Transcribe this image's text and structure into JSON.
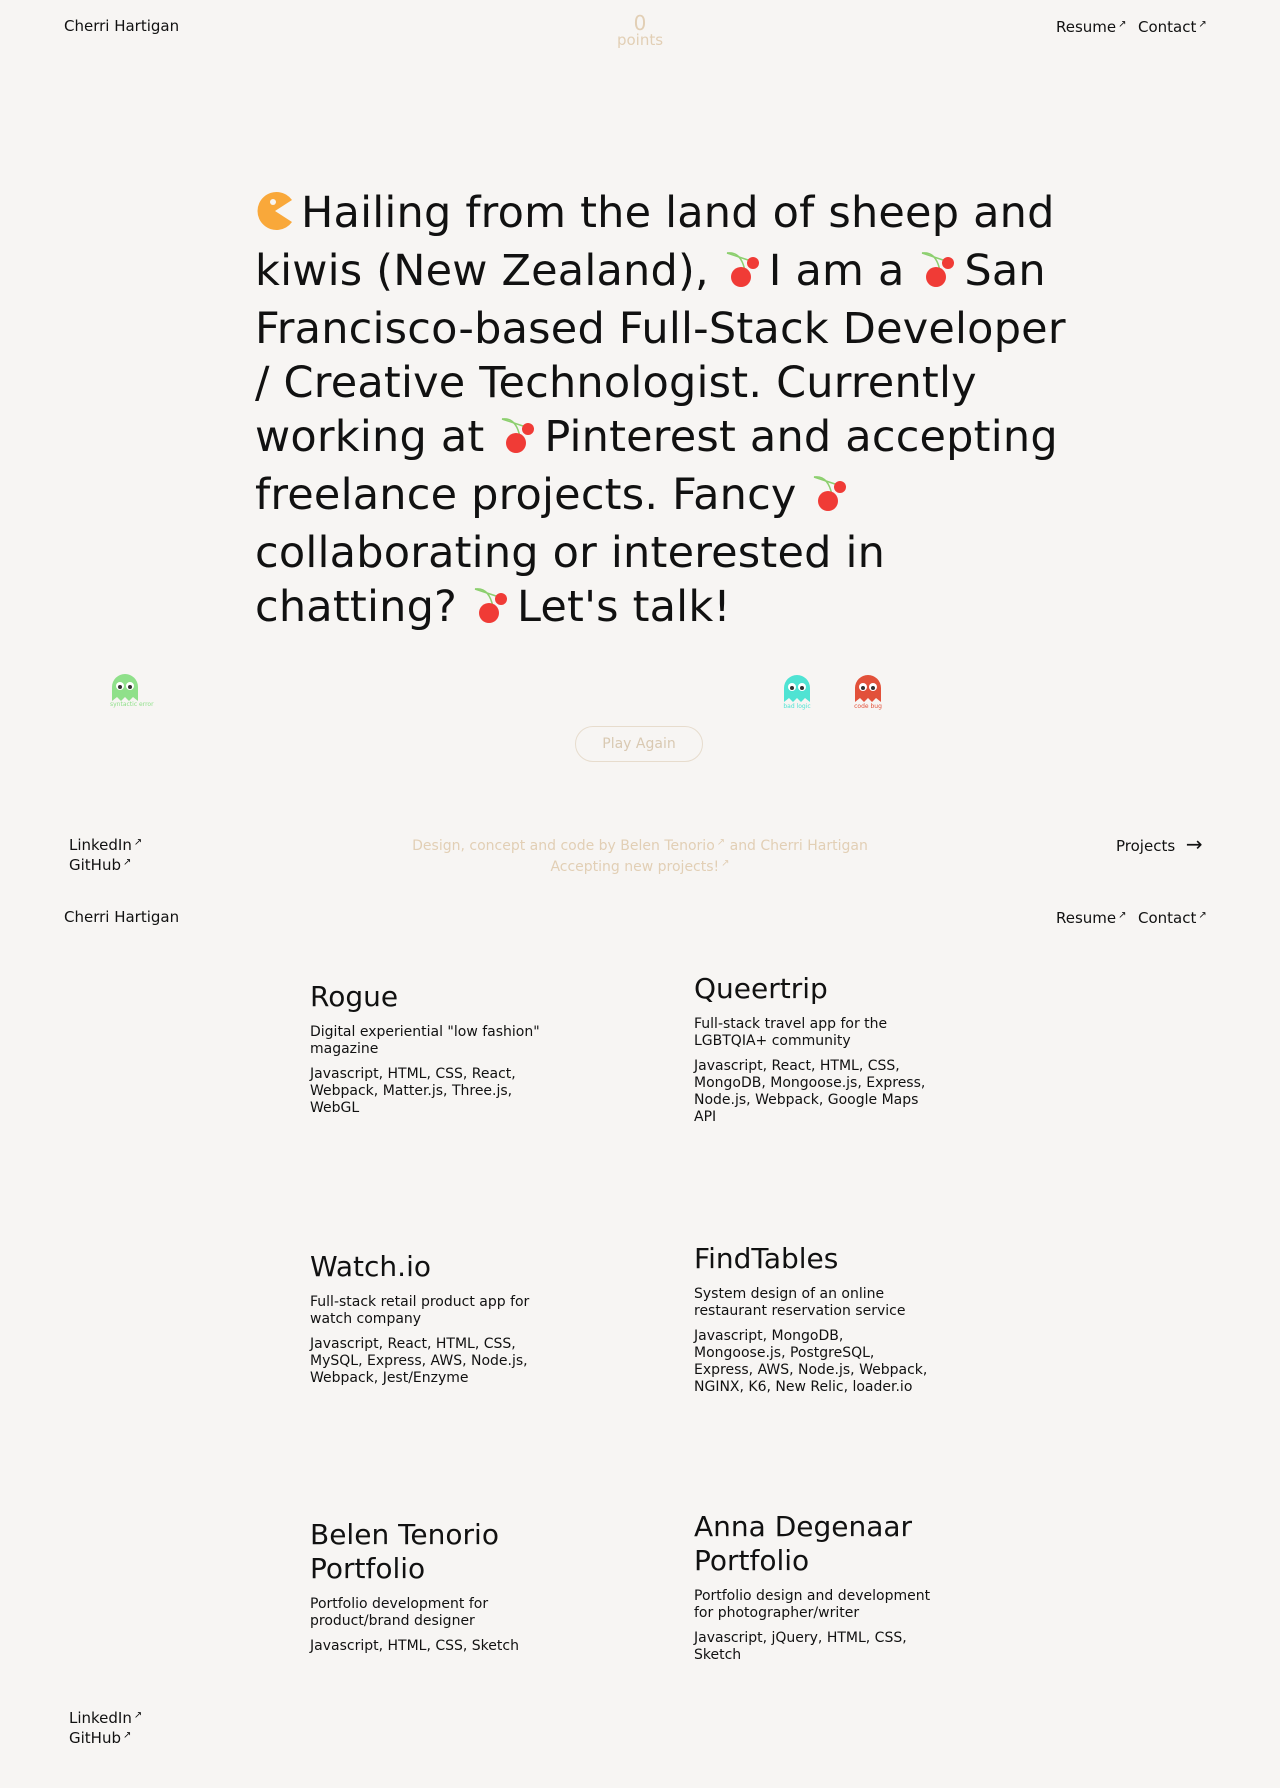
{
  "header": {
    "name": "Cherri Hartigan",
    "score_value": "0",
    "score_label": "points",
    "resume_label": "Resume",
    "contact_label": "Contact",
    "external_mark": "↗"
  },
  "hero": {
    "seg1": "Hailing from the land of sheep and kiwis (New Zealand),",
    "seg2": "I am a",
    "seg3": "San Francisco-based Full-Stack Developer / Creative Technologist. Currently working at",
    "seg4": "Pinterest and accepting freelance projects. Fancy",
    "seg5": "collaborating or interested in chatting?",
    "seg6": "Let's talk!"
  },
  "ghosts": [
    {
      "label": "syntactic error",
      "color": "#8fe08a"
    },
    {
      "label": "bad logic",
      "color": "#4fe3d3"
    },
    {
      "label": "code bug",
      "color": "#e2513a"
    }
  ],
  "colors": {
    "pacman": "#f9a83a",
    "cherry": "#f03b36",
    "stem": "#8ccf6e"
  },
  "play_again_label": "Play Again",
  "footer": {
    "linkedin": "LinkedIn",
    "github": "GitHub",
    "credit_prefix": "Design, concept and code by Belen Tenorio",
    "credit_suffix": "and Cherri Hartigan",
    "accepting": "Accepting new projects!",
    "projects_label": "Projects",
    "projects_arrow": "→"
  },
  "projects": [
    {
      "title": "Rogue",
      "desc": "Digital experiential \"low fashion\" magazine",
      "tech": "Javascript, HTML, CSS, React, Webpack, Matter.js, Three.js, WebGL"
    },
    {
      "title": "Queertrip",
      "desc": "Full-stack travel app for the LGBTQIA+ community",
      "tech": "Javascript, React, HTML, CSS, MongoDB, Mongoose.js, Express, Node.js, Webpack, Google Maps API"
    },
    {
      "title": "Watch.io",
      "desc": "Full-stack retail product app for watch company",
      "tech": "Javascript, React, HTML, CSS, MySQL, Express, AWS, Node.js, Webpack, Jest/Enzyme"
    },
    {
      "title": "FindTables",
      "desc": "System design of an online restaurant reservation service",
      "tech": "Javascript, MongoDB, Mongoose.js, PostgreSQL, Express, AWS, Node.js, Webpack, NGINX, K6, New Relic, loader.io"
    },
    {
      "title": "Belen Tenorio Portfolio",
      "desc": "Portfolio development for product/brand designer",
      "tech": "Javascript, HTML, CSS, Sketch"
    },
    {
      "title": "Anna Degenaar Portfolio",
      "desc": "Portfolio design and development for photographer/writer",
      "tech": "Javascript, jQuery, HTML, CSS, Sketch"
    }
  ]
}
